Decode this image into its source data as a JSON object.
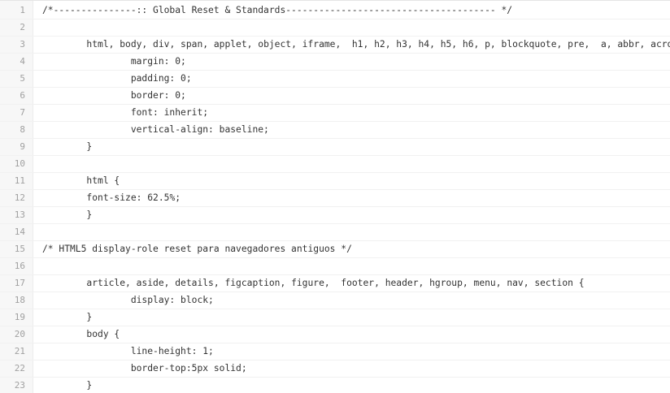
{
  "editor": {
    "lines": [
      {
        "number": "1",
        "text": "/*---------------:: Global Reset & Standards-------------------------------------- */"
      },
      {
        "number": "2",
        "text": ""
      },
      {
        "number": "3",
        "text": "\thtml, body, div, span, applet, object, iframe,  h1, h2, h3, h4, h5, h6, p, blockquote, pre,  a, abbr, acronym"
      },
      {
        "number": "4",
        "text": "\t\tmargin: 0;"
      },
      {
        "number": "5",
        "text": "\t\tpadding: 0;"
      },
      {
        "number": "6",
        "text": "\t\tborder: 0;"
      },
      {
        "number": "7",
        "text": "\t\tfont: inherit;"
      },
      {
        "number": "8",
        "text": "\t\tvertical-align: baseline;"
      },
      {
        "number": "9",
        "text": "\t}"
      },
      {
        "number": "10",
        "text": ""
      },
      {
        "number": "11",
        "text": "\thtml {"
      },
      {
        "number": "12",
        "text": "\tfont-size: 62.5%;"
      },
      {
        "number": "13",
        "text": "\t}"
      },
      {
        "number": "14",
        "text": ""
      },
      {
        "number": "15",
        "text": "/* HTML5 display-role reset para navegadores antiguos */"
      },
      {
        "number": "16",
        "text": ""
      },
      {
        "number": "17",
        "text": "\tarticle, aside, details, figcaption, figure,  footer, header, hgroup, menu, nav, section {"
      },
      {
        "number": "18",
        "text": "\t\tdisplay: block;"
      },
      {
        "number": "19",
        "text": "\t}"
      },
      {
        "number": "20",
        "text": "\tbody {"
      },
      {
        "number": "21",
        "text": "\t\tline-height: 1;"
      },
      {
        "number": "22",
        "text": "\t\tborder-top:5px solid;"
      },
      {
        "number": "23",
        "text": "\t}"
      }
    ]
  }
}
